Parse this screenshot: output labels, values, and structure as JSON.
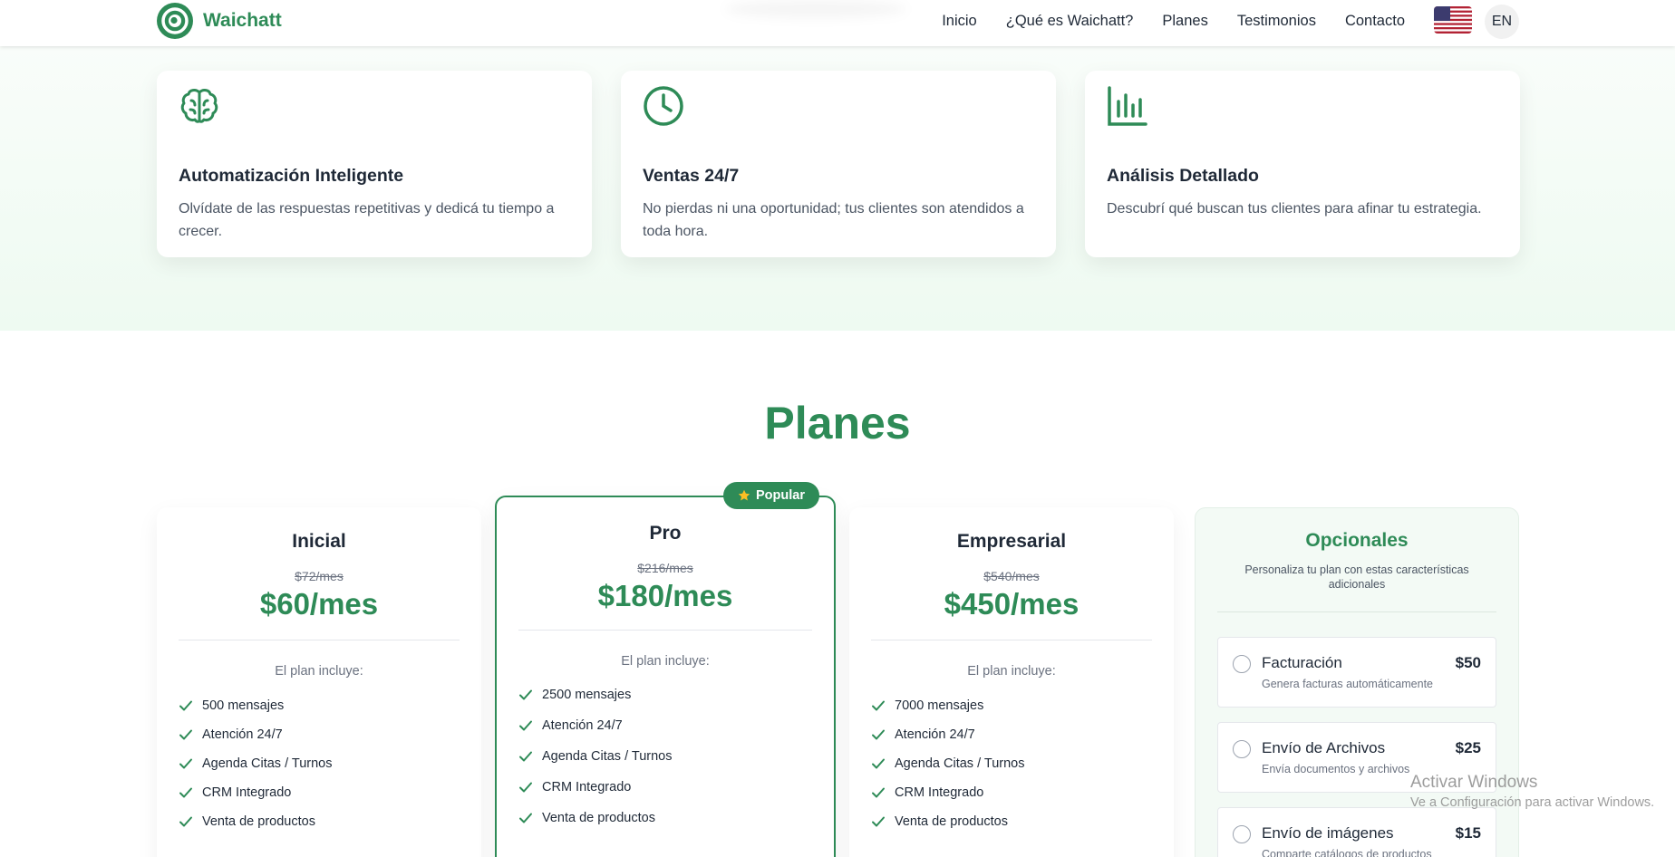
{
  "nav": {
    "brand": "Waichatt",
    "links": [
      "Inicio",
      "¿Qué es Waichatt?",
      "Planes",
      "Testimonios",
      "Contacto"
    ],
    "language": "EN",
    "flag_icon": "us-flag-icon"
  },
  "features": [
    {
      "icon": "brain-icon",
      "title": "Automatización Inteligente",
      "desc": "Olvídate de las respuestas repetitivas y dedicá tu tiempo a crecer."
    },
    {
      "icon": "clock-icon",
      "title": "Ventas 24/7",
      "desc": "No pierdas ni una oportunidad; tus clientes son atendidos a toda hora."
    },
    {
      "icon": "bar-chart-icon",
      "title": "Análisis Detallado",
      "desc": "Descubrí qué buscan tus clientes para afinar tu estrategia."
    }
  ],
  "planes": {
    "title": "Planes",
    "plans": [
      {
        "name": "Inicial",
        "old_price": "$72/mes",
        "price": "$60/mes",
        "includes": "El plan incluye:",
        "features": [
          "500 mensajes",
          "Atención 24/7",
          "Agenda Citas / Turnos",
          "CRM Integrado",
          "Venta de productos"
        ]
      },
      {
        "name": "Pro",
        "badge": "Popular",
        "old_price": "$216/mes",
        "price": "$180/mes",
        "includes": "El plan incluye:",
        "features": [
          "2500 mensajes",
          "Atención 24/7",
          "Agenda Citas / Turnos",
          "CRM Integrado",
          "Venta de productos"
        ]
      },
      {
        "name": "Empresarial",
        "old_price": "$540/mes",
        "price": "$450/mes",
        "includes": "El plan incluye:",
        "features": [
          "7000 mensajes",
          "Atención 24/7",
          "Agenda Citas / Turnos",
          "CRM Integrado",
          "Venta de productos"
        ]
      }
    ]
  },
  "opcionales": {
    "title": "Opcionales",
    "subtitle": "Personaliza tu plan con estas características adicionales",
    "items": [
      {
        "name": "Facturación",
        "price": "$50",
        "desc": "Genera facturas automáticamente"
      },
      {
        "name": "Envío de Archivos",
        "price": "$25",
        "desc": "Envía documentos y archivos"
      },
      {
        "name": "Envío de imágenes",
        "price": "$15",
        "desc": "Comparte catálogos de productos"
      }
    ]
  },
  "watermark": {
    "title": "Activar Windows",
    "subtitle": "Ve a Configuración para activar Windows."
  },
  "colors": {
    "accent": "#2e8b57",
    "features_background": "#eefaf1",
    "opcionales_background": "#f3faf5"
  }
}
